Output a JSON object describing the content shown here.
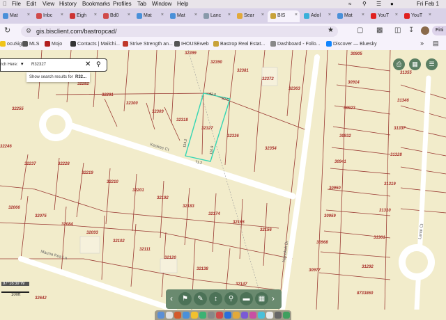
{
  "menubar": {
    "items": [
      "File",
      "Edit",
      "View",
      "History",
      "Bookmarks",
      "Profiles",
      "Tab",
      "Window",
      "Help"
    ],
    "clock": "Fri Feb 1"
  },
  "tabs": [
    {
      "label": "Mat",
      "color": "#4a90d9"
    },
    {
      "label": "Inbc",
      "color": "#d04a4a"
    },
    {
      "label": "Eigh",
      "color": "#cc3333"
    },
    {
      "label": "Bd0",
      "color": "#d04a4a"
    },
    {
      "label": "Mat",
      "color": "#4a90d9"
    },
    {
      "label": "Mat",
      "color": "#4a90d9"
    },
    {
      "label": "Lanc",
      "color": "#8899aa"
    },
    {
      "label": "Sear",
      "color": "#e2a93a"
    },
    {
      "label": "BIS",
      "color": "#c8a23a"
    },
    {
      "label": "Adol",
      "color": "#3ab0d9"
    },
    {
      "label": "Mat",
      "color": "#4a90d9"
    },
    {
      "label": "YouT",
      "color": "#e02020"
    },
    {
      "label": "YouT",
      "color": "#e02020"
    }
  ],
  "address": {
    "url": "gis.bisclient.com/bastropcad/",
    "profile_button": "Fini"
  },
  "bookmarks": [
    {
      "label": "ocuSign",
      "color": "#f0c419"
    },
    {
      "label": "MLS",
      "color": "#555555"
    },
    {
      "label": "Mojo",
      "color": "#b11e1e"
    },
    {
      "label": "Contacts | Mailchi...",
      "color": "#333333"
    },
    {
      "label": "Strive Strength an...",
      "color": "#c0392b"
    },
    {
      "label": "IHOUSEweb",
      "color": "#555555"
    },
    {
      "label": "Bastrop Real Estat...",
      "color": "#c8a23a"
    },
    {
      "label": "Dashboard - Follo...",
      "color": "#888888"
    },
    {
      "label": "Discover — Bluesky",
      "color": "#1185fe"
    }
  ],
  "search": {
    "prefix": "rch Here:",
    "value": "R32327",
    "suggestion_prefix": "Show search results for",
    "suggestion_term": "R32..."
  },
  "streets": [
    "Keokee Ct",
    "Mauna Kea Ln",
    "Nanakuli Dr",
    "Lanai Ct"
  ],
  "parcels": [
    "32399",
    "32390",
    "32381",
    "32372",
    "32363",
    "32282",
    "32291",
    "32300",
    "32309",
    "32318",
    "32327",
    "32336",
    "32354",
    "32255",
    "32246",
    "32237",
    "32228",
    "32219",
    "32210",
    "32201",
    "32192",
    "32183",
    "32174",
    "32165",
    "32156",
    "32066",
    "32075",
    "32084",
    "32093",
    "32102",
    "32111",
    "32120",
    "32138",
    "32147",
    "32642",
    "30905",
    "30914",
    "30923",
    "30932",
    "30941",
    "30950",
    "30959",
    "30968",
    "30977",
    "31355",
    "31346",
    "31337",
    "31328",
    "31319",
    "31310",
    "31301",
    "31292",
    "8733860"
  ],
  "dimensions": [
    "42.0",
    "50.6",
    "114.2",
    "110.9",
    "71.2"
  ],
  "scale": {
    "coord": "97°16'39\"W",
    "label": "100ft"
  },
  "toolbar": {
    "prev": "‹",
    "next": "›"
  },
  "colors": {
    "map_bg": "#f2eccb",
    "parcel_line": "#9a3a33",
    "selected": "#35d6b3",
    "label": "#a8302a",
    "toolbar": "#6a8a6f"
  }
}
